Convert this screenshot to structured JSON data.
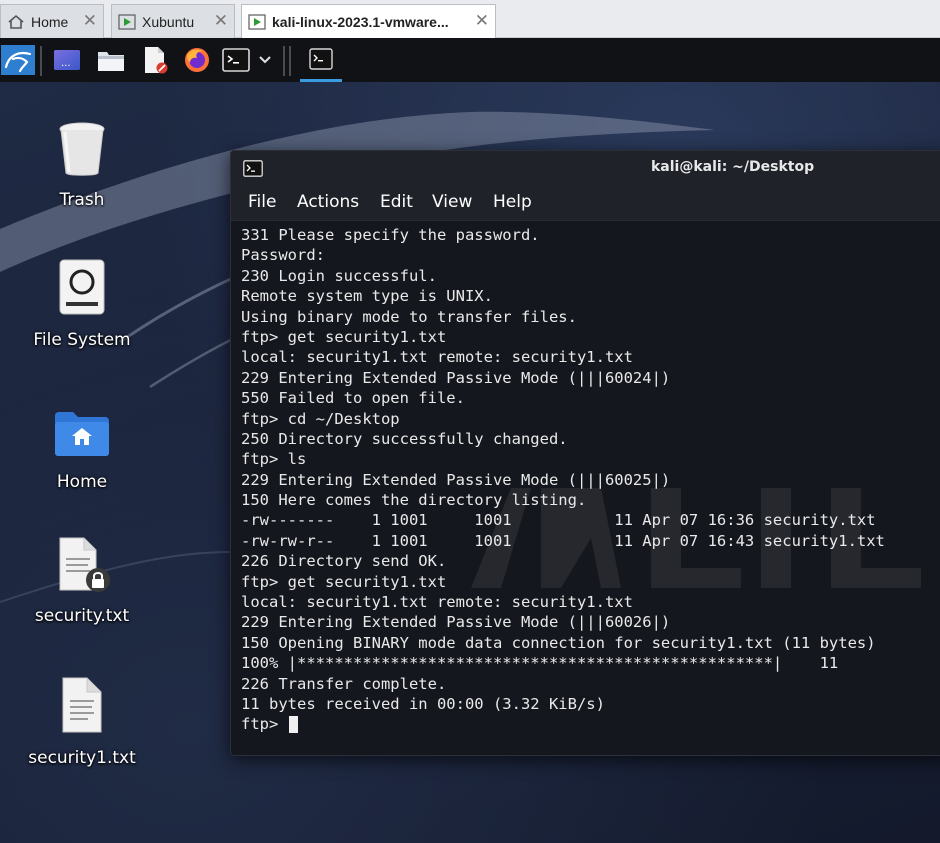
{
  "browser_tabs": [
    {
      "label": "Home",
      "icon": "home-icon"
    },
    {
      "label": "Xubuntu",
      "icon": "vm-play-icon"
    },
    {
      "label": "kali-linux-2023.1-vmware...",
      "icon": "vm-play-icon"
    }
  ],
  "panel": {
    "launchers": [
      "kali-menu-icon",
      "desktop-icon",
      "file-manager-icon",
      "text-editor-icon",
      "firefox-icon",
      "terminal-icon",
      "dropdown-chevron-icon"
    ],
    "active_task": "terminal-icon"
  },
  "desktop": {
    "icons": [
      {
        "label": "Trash",
        "icon": "trash-icon"
      },
      {
        "label": "File System",
        "icon": "drive-icon"
      },
      {
        "label": "Home",
        "icon": "home-folder-icon"
      },
      {
        "label": "security.txt",
        "icon": "locked-file-icon"
      },
      {
        "label": "security1.txt",
        "icon": "text-file-icon"
      }
    ]
  },
  "terminal": {
    "title": "kali@kali: ~/Desktop",
    "menu": [
      "File",
      "Actions",
      "Edit",
      "View",
      "Help"
    ],
    "lines": [
      "331 Please specify the password.",
      "Password:",
      "230 Login successful.",
      "Remote system type is UNIX.",
      "Using binary mode to transfer files.",
      "ftp> get security1.txt",
      "local: security1.txt remote: security1.txt",
      "229 Entering Extended Passive Mode (|||60024|)",
      "550 Failed to open file.",
      "ftp> cd ~/Desktop",
      "250 Directory successfully changed.",
      "ftp> ls",
      "229 Entering Extended Passive Mode (|||60025|)",
      "150 Here comes the directory listing.",
      "-rw-------    1 1001     1001           11 Apr 07 16:36 security.txt",
      "-rw-rw-r--    1 1001     1001           11 Apr 07 16:43 security1.txt",
      "226 Directory send OK.",
      "ftp> get security1.txt",
      "local: security1.txt remote: security1.txt",
      "229 Entering Extended Passive Mode (|||60026|)",
      "150 Opening BINARY mode data connection for security1.txt (11 bytes)",
      "100% |***************************************************|    11",
      "226 Transfer complete.",
      "11 bytes received in 00:00 (3.32 KiB/s)"
    ],
    "prompt": "ftp> "
  },
  "colors": {
    "panel_bg": "#111216",
    "terminal_bg": "#15171e",
    "accent": "#3b9be0"
  }
}
